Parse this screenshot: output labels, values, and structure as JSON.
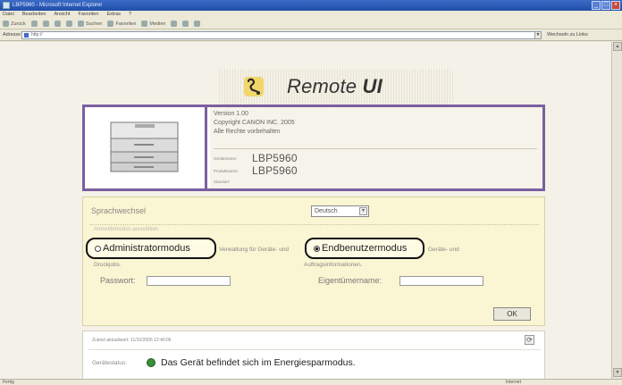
{
  "window": {
    "title": "LBP5960 - Microsoft Internet Explorer",
    "controls": [
      "_",
      "□",
      "×"
    ]
  },
  "menu": [
    "Datei",
    "Bearbeiten",
    "Ansicht",
    "Favoriten",
    "Extras",
    "?"
  ],
  "toolbar": {
    "back": "Zurück",
    "search": "Suchen",
    "favorites": "Favoriten",
    "media": "Medien"
  },
  "address": {
    "label": "Adresse",
    "url": "http://",
    "go": "Wechseln zu",
    "links": "Links"
  },
  "header": {
    "logo_text": "Remote",
    "logo_bold": "UI"
  },
  "device": {
    "version": "Version 1.00",
    "copyright": "Copyright CANON INC. 2005",
    "rights": "Alle Rechte vorbehalten",
    "device_name_label": "Gerätename:",
    "device_name": "LBP5960",
    "product_name_label": "Produktname:",
    "product_name": "LBP5960",
    "location_label": "Standort:"
  },
  "login": {
    "language_label": "Sprachwechsel",
    "language_value": "Deutsch",
    "mode_header": "Anmeldemodus auswählen",
    "admin_mode": "Administratormodus",
    "admin_desc_1": "Verwaltung für Geräte- und",
    "admin_desc_2": "Druckjobs.",
    "enduser_mode": "Endbenutzermodus",
    "enduser_desc_1": "Geräte- und",
    "enduser_desc_2": "Auftragsinformationen.",
    "password_label": "Passwort:",
    "owner_label": "Eigentümername:",
    "ok_label": "OK"
  },
  "status": {
    "last_update": "Zuletzt aktualisiert: 11/10/2005 12:40:06",
    "device_status_label": "Gerätestatus:",
    "device_status_text": "Das Gerät befindet sich im Energiesparmodus.",
    "status_color": "#3a8f3a"
  },
  "statusbar": {
    "left": "Fertig",
    "zone": "Internet"
  }
}
